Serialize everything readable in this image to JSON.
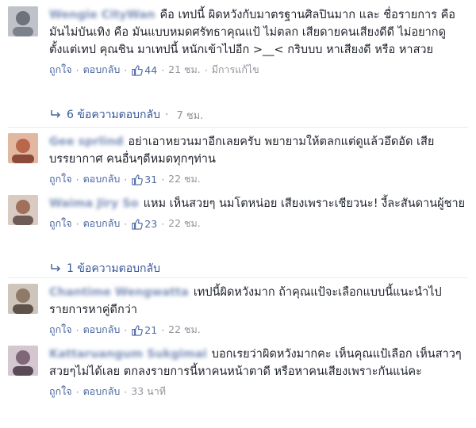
{
  "comments": [
    {
      "author": "Wengie CityWan",
      "text": "คือ เทปนี้ ผิดหวังกับมาตรฐานศิลปินมาก และ ชื่อรายการ คือมันไม่บันเทิง คือ มันแบบหมดศรัทธาคุณแป้ ไม่ตลก เสียดายคนเสียงดีดี ไม่อยากดูตั้งแต่เทป คุณชิน มาเทปนี้ หนักเข้าไปอีก >__< กริบบบ หาเสียงดี หรือ หาสวย",
      "like": "ถูกใจ",
      "reply": "ตอบกลับ",
      "likes": "44",
      "time": "21 ชม.",
      "edited": "มีการแก้ไข",
      "replies": "6 ข้อความตอบกลับ",
      "replies_time": "7 ชม.",
      "avatar_color": "#8a8f9a"
    },
    {
      "author": "Gee sprlind",
      "text": "อย่าเอาหยวนมาอีกเลยครับ พยายามให้ตลกแต่ดูแล้วอึดอัด เสียบรรยากาศ คนอื่นๆดีหมดทุกๆท่าน",
      "like": "ถูกใจ",
      "reply": "ตอบกลับ",
      "likes": "31",
      "time": "22 ชม.",
      "avatar_color": "#c27b5a"
    },
    {
      "author": "Waima Jiry So",
      "text": "แหม เห็นสวยๆ นมโตหน่อย เสียงเพราะเชียวนะ! งี้ละสันดานผู้ชาย",
      "like": "ถูกใจ",
      "reply": "ตอบกลับ",
      "likes": "23",
      "time": "22 ชม.",
      "replies": "1 ข้อความตอบกลับ",
      "avatar_color": "#b59a8e"
    },
    {
      "author": "Chantime Wengwatta",
      "text": "เทปนี้ผิดหวังมาก ถ้าคุณแป้จะเลือกแบบนี้แนะนำไปรายการหาคู่ดีกว่า",
      "like": "ถูกใจ",
      "reply": "ตอบกลับ",
      "likes": "21",
      "time": "22 ชม.",
      "avatar_color": "#9a8a78"
    },
    {
      "author": "Kattaruangum Sukgimai",
      "text": "บอกเรยว่าผิดหวังมากคะ เห็นคุณแป้เลือก เห็นสาวๆสวยๆไม่ได้เลย ตกลงรายการนี้หาคนหน้าตาดี หรือหาคนเสียงเพราะกันแน่คะ",
      "like": "ถูกใจ",
      "reply": "ตอบกลับ",
      "time": "33 นาที",
      "avatar_color": "#8d7a8c"
    }
  ],
  "colors": {
    "link": "#4b67a1",
    "meta": "#90949c",
    "author": "#7b8fb8"
  },
  "icons": {
    "like": "thumbs-up-icon",
    "reply_arrow": "reply-arrow-icon"
  }
}
